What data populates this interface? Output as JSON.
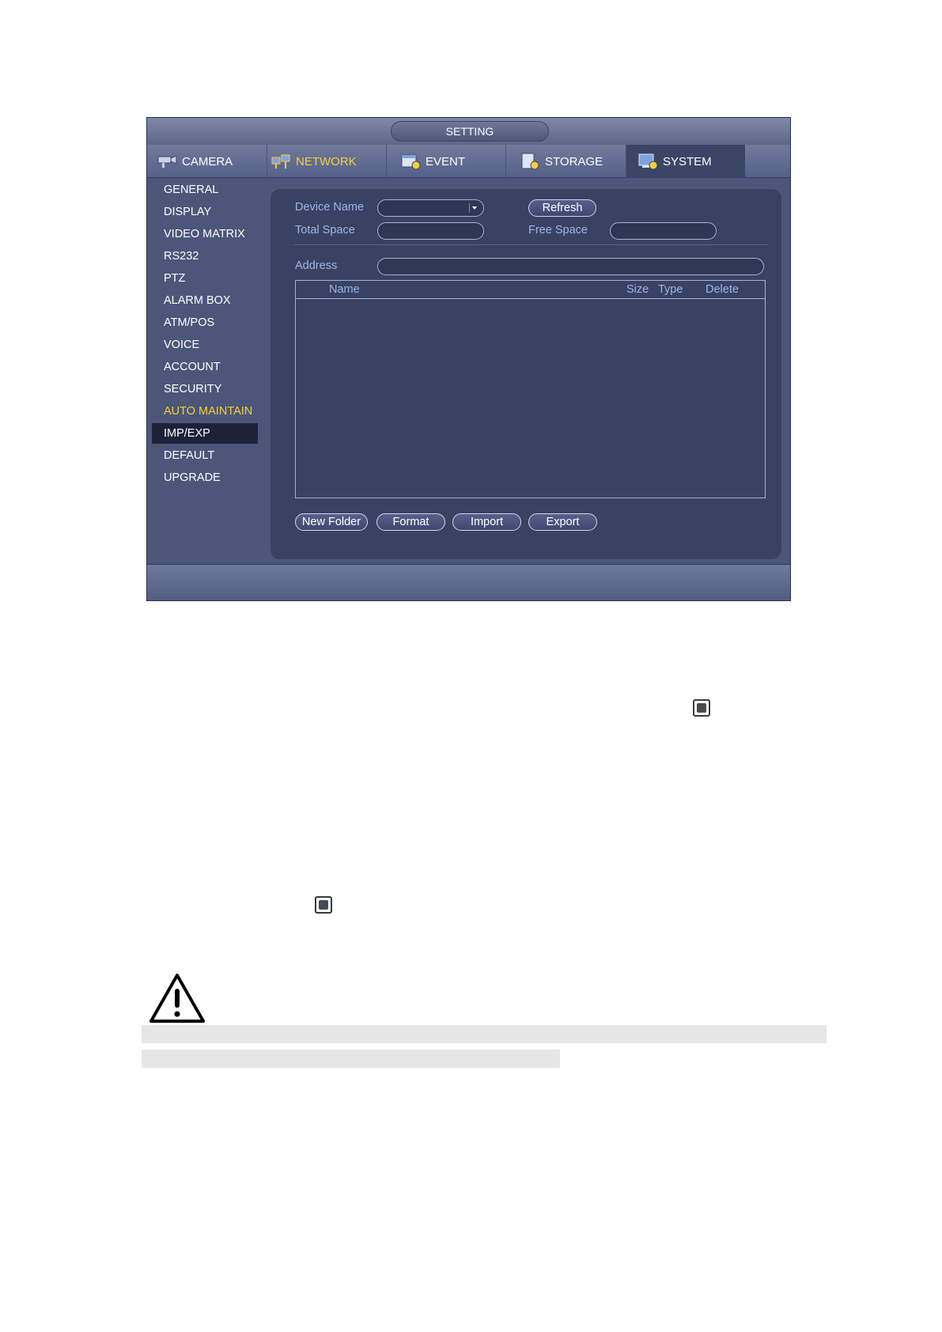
{
  "window": {
    "title": "SETTING",
    "tabs": [
      {
        "label": "CAMERA",
        "icon": "camera-icon",
        "color": "#ffffff"
      },
      {
        "label": "NETWORK",
        "icon": "network-icon",
        "color": "#f6cf3a"
      },
      {
        "label": "EVENT",
        "icon": "event-icon",
        "color": "#ffffff"
      },
      {
        "label": "STORAGE",
        "icon": "storage-icon",
        "color": "#ffffff"
      },
      {
        "label": "SYSTEM",
        "icon": "system-icon",
        "color": "#ffffff",
        "active": true
      }
    ],
    "sidebar": {
      "items": [
        {
          "label": "GENERAL"
        },
        {
          "label": "DISPLAY"
        },
        {
          "label": "VIDEO MATRIX"
        },
        {
          "label": "RS232"
        },
        {
          "label": "PTZ"
        },
        {
          "label": "ALARM BOX"
        },
        {
          "label": "ATM/POS"
        },
        {
          "label": "VOICE"
        },
        {
          "label": "ACCOUNT"
        },
        {
          "label": "SECURITY"
        },
        {
          "label": "AUTO MAINTAIN",
          "highlight": "#f6cf3a"
        },
        {
          "label": "IMP/EXP",
          "selected": true
        },
        {
          "label": "DEFAULT"
        },
        {
          "label": "UPGRADE"
        }
      ]
    },
    "form": {
      "device_name_label": "Device Name",
      "device_name_value": "",
      "refresh_label": "Refresh",
      "total_space_label": "Total Space",
      "total_space_value": "",
      "free_space_label": "Free Space",
      "free_space_value": "",
      "address_label": "Address",
      "address_value": ""
    },
    "table": {
      "columns": [
        "Name",
        "Size",
        "Type",
        "Delete"
      ],
      "rows": []
    },
    "buttons": {
      "new_folder": "New Folder",
      "format": "Format",
      "import": "Import",
      "export": "Export"
    }
  },
  "colors": {
    "accent_yellow": "#f6cf3a",
    "label_blue": "#9db6ea",
    "panel_bg": "#394262"
  }
}
